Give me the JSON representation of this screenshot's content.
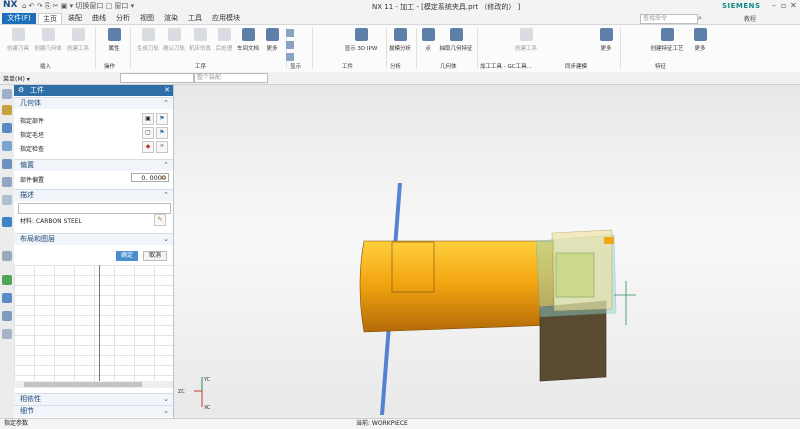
{
  "title_bar": {
    "logo": "NX",
    "window_title": "NX 11 - 加工 - [模定系统夹具.prt （修改的） ]",
    "brand": "SIEMENS",
    "quick_access": "⌂ ↶ ↷ ⎘ ✂ ▣ ▾ 切换窗口 □ 窗口 ▾"
  },
  "menu": {
    "file_button": "文件(F)",
    "tabs": [
      "主页",
      "装配",
      "曲线",
      "分析",
      "视图",
      "渲染",
      "工具",
      "应用模块"
    ],
    "active_tab": "主页",
    "search_placeholder": "查找命令",
    "help": "教程"
  },
  "ribbon": {
    "buttons": [
      {
        "label": "创建刀具",
        "enabled": false
      },
      {
        "label": "创建几何体",
        "enabled": false
      },
      {
        "label": "创建工序",
        "enabled": false
      },
      {
        "label": "属性",
        "enabled": true
      },
      {
        "label": "生成刀轨",
        "enabled": false
      },
      {
        "label": "确认刀轨",
        "enabled": false
      },
      {
        "label": "机床仿真",
        "enabled": false
      },
      {
        "label": "后处理",
        "enabled": false
      },
      {
        "label": "车间文档",
        "enabled": true
      },
      {
        "label": "更多",
        "enabled": true
      },
      {
        "label": "显示 3D IPW",
        "enabled": true
      },
      {
        "label": "拔模分析",
        "enabled": true
      },
      {
        "label": "点",
        "enabled": true
      },
      {
        "label": "抽取几何特征",
        "enabled": true
      },
      {
        "label": "创建工序",
        "enabled": false
      },
      {
        "label": "更多",
        "enabled": true
      },
      {
        "label": "创建特征工艺",
        "enabled": true
      },
      {
        "label": "更多",
        "enabled": true
      }
    ],
    "groups": [
      "插入",
      "操作",
      "工序",
      "显示",
      "工件",
      "分析",
      "几何体",
      "加工工具 - GC工具...",
      "同步建模",
      "特征"
    ]
  },
  "toolbar": {
    "menu_label": "菜单(M) ▾",
    "filter_placeholder": "",
    "assembly_select": "整个装配"
  },
  "panel": {
    "title": "工件",
    "sections": {
      "geometry": "几何体",
      "offset": "偏置",
      "description": "描述",
      "layout": "布局和图层",
      "dependencies": "相依性",
      "details": "细节"
    },
    "geometry_rows": [
      "指定部件",
      "指定毛坯",
      "指定检查"
    ],
    "offset_label": "部件偏置",
    "offset_value": "0. 0000",
    "material_label": "材料: CARBON STEEL",
    "ok_button": "确定",
    "cancel_button": "取消"
  },
  "viewport": {
    "axis_labels": [
      "ZC",
      "YC",
      "XC"
    ]
  },
  "status": {
    "left": "指定参数",
    "center": "当前: WORKPIECE"
  },
  "colors": {
    "accent": "#2f6fa8",
    "file_button": "#1b6fb8",
    "part_orange": "#f3a712",
    "blank_cyan": "#7fd3d0",
    "plane_blue": "#3a6fcf"
  }
}
